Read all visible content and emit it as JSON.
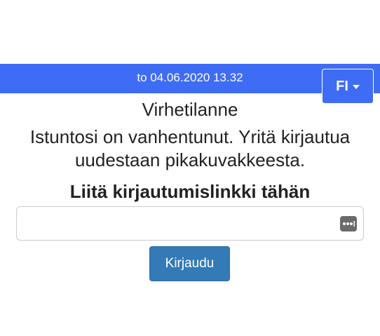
{
  "header": {
    "datetime": "to 04.06.2020 13.32",
    "language_button_label": "FI",
    "bar_color": "#3f6cf5"
  },
  "error": {
    "title": "Virhetilanne",
    "message": "Istuntosi on vanhentunut. Yritä kirjautua uudestaan pikakuvakkeesta."
  },
  "login": {
    "link_label": "Liitä kirjautumislinkki tähän",
    "link_input_value": "",
    "link_input_placeholder": "",
    "field_icon": "password-manager-key-icon",
    "submit_label": "Kirjaudu",
    "submit_color": "#337ab7"
  }
}
